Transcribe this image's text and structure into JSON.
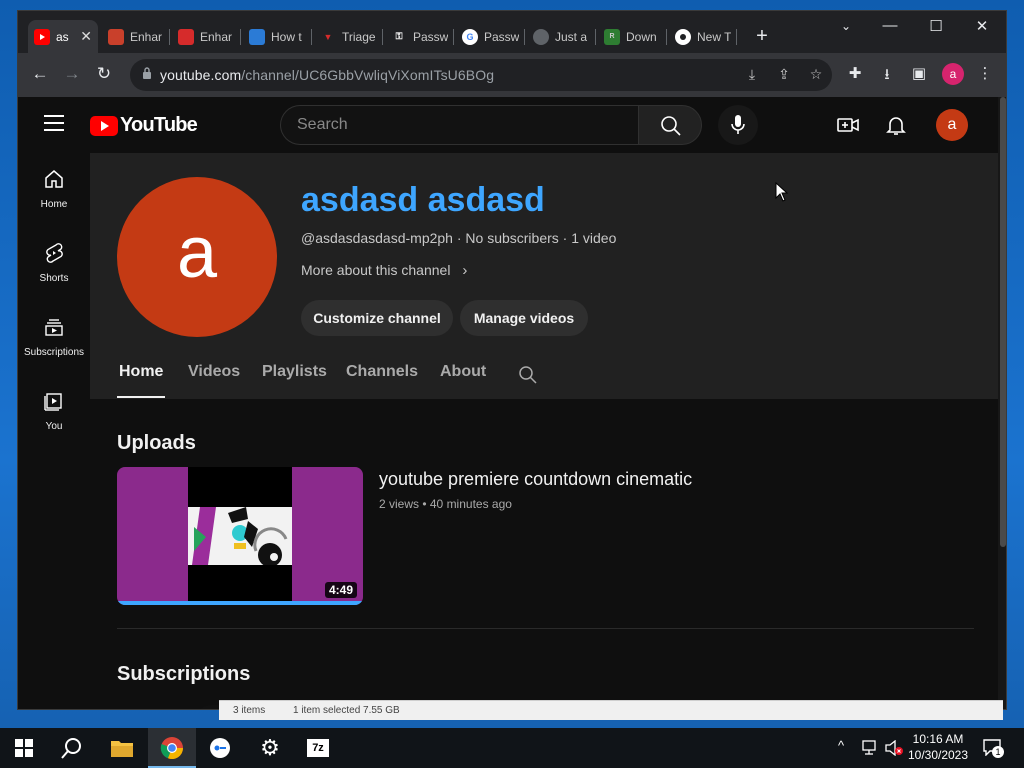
{
  "browser": {
    "tabs": [
      {
        "label": "as",
        "favicon": "youtube-icon",
        "color": "#ff0000",
        "active": true
      },
      {
        "label": "Enhar",
        "favicon": "enhance-icon",
        "color": "#c9402b",
        "active": false
      },
      {
        "label": "Enhar",
        "favicon": "wand-icon",
        "color": "#d62b2b",
        "active": false
      },
      {
        "label": "How t",
        "favicon": "monitor-icon",
        "color": "#2b7bd6",
        "active": false
      },
      {
        "label": "Triage",
        "favicon": "triage-icon",
        "color": "#d62b2b",
        "active": false
      },
      {
        "label": "Passw",
        "favicon": "key-icon",
        "color": "#ffffff",
        "active": false
      },
      {
        "label": "Passw",
        "favicon": "google-icon",
        "color": "#4285f4",
        "active": false
      },
      {
        "label": "Just a",
        "favicon": "globe-icon",
        "color": "#9aa0a6",
        "active": false
      },
      {
        "label": "Down",
        "favicon": "rom-icon",
        "color": "#2e7d32",
        "active": false
      },
      {
        "label": "New T",
        "favicon": "chrome-icon",
        "color": "#ffffff",
        "active": false
      }
    ],
    "new_tab": "+",
    "url_domain": "youtube.com",
    "url_path": "/channel/UC6GbbVwliqViXomITsU6BOg",
    "profile_letter": "a"
  },
  "youtube": {
    "logo_text": "YouTube",
    "search_placeholder": "Search",
    "avatar_letter": "a",
    "guide": [
      {
        "label": "Home",
        "icon": "home-icon"
      },
      {
        "label": "Shorts",
        "icon": "shorts-icon"
      },
      {
        "label": "Subscriptions",
        "icon": "subscriptions-icon"
      },
      {
        "label": "You",
        "icon": "you-icon"
      }
    ],
    "channel": {
      "avatar_letter": "a",
      "name": "asdasd asdasd",
      "meta": "@asdasdasdasd-mp2ph · No subscribers · 1 video",
      "more": "More about this channel",
      "customize_label": "Customize channel",
      "manage_label": "Manage videos",
      "tabs": [
        "Home",
        "Videos",
        "Playlists",
        "Channels",
        "About"
      ]
    },
    "uploads": {
      "title": "Uploads",
      "video": {
        "title": "youtube premiere countdown cinematic",
        "meta": "2 views • 40 minutes ago",
        "duration": "4:49"
      }
    },
    "subscriptions_title": "Subscriptions"
  },
  "bg_window": {
    "items": "3 items",
    "selected": "1 item selected  7.55 GB"
  },
  "taskbar": {
    "time": "10:16 AM",
    "date": "10/30/2023",
    "notification_count": "1"
  }
}
